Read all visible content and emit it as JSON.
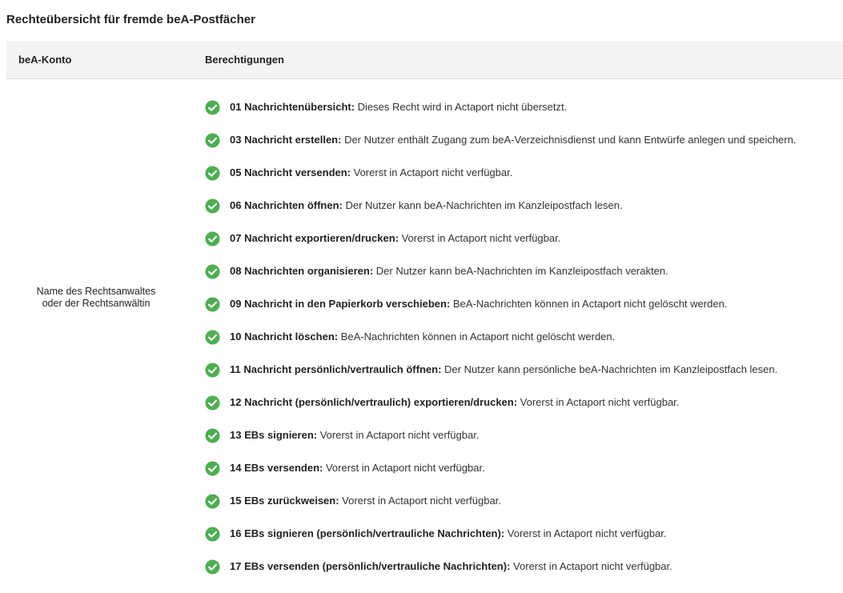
{
  "page": {
    "title": "Rechteübersicht für fremde beA-Postfächer"
  },
  "table": {
    "headers": {
      "account": "beA-Konto",
      "permissions": "Berechtigungen"
    },
    "account": {
      "line1": "Name des Rechtsanwaltes",
      "line2": "oder der Rechtsanwältin"
    },
    "check_icon": "check-circle-icon",
    "check_color": "#4caf50",
    "permissions": [
      {
        "name": "01 Nachrichtenübersicht:",
        "description": " Dieses Recht wird in Actaport nicht übersetzt."
      },
      {
        "name": "03 Nachricht erstellen:",
        "description": " Der Nutzer enthält Zugang zum beA-Verzeichnisdienst und kann Entwürfe anlegen und speichern."
      },
      {
        "name": "05 Nachricht versenden:",
        "description": " Vorerst in Actaport nicht verfügbar."
      },
      {
        "name": "06 Nachrichten öffnen:",
        "description": " Der Nutzer kann beA-Nachrichten im Kanzleipostfach lesen."
      },
      {
        "name": "07 Nachricht exportieren/drucken:",
        "description": " Vorerst in Actaport nicht verfügbar."
      },
      {
        "name": "08 Nachrichten organisieren:",
        "description": " Der Nutzer kann beA-Nachrichten im Kanzleipostfach verakten."
      },
      {
        "name": "09 Nachricht in den Papierkorb verschieben:",
        "description": " BeA-Nachrichten können in Actaport nicht gelöscht werden."
      },
      {
        "name": "10 Nachricht löschen:",
        "description": " BeA-Nachrichten können in Actaport nicht gelöscht werden."
      },
      {
        "name": "11 Nachricht persönlich/vertraulich öffnen:",
        "description": " Der Nutzer kann persönliche beA-Nachrichten im Kanzleipostfach lesen."
      },
      {
        "name": "12 Nachricht (persönlich/vertraulich) exportieren/drucken:",
        "description": " Vorerst in Actaport nicht verfügbar."
      },
      {
        "name": "13 EBs signieren:",
        "description": " Vorerst in Actaport nicht verfügbar."
      },
      {
        "name": "14 EBs versenden:",
        "description": " Vorerst in Actaport nicht verfügbar."
      },
      {
        "name": "15 EBs zurückweisen:",
        "description": " Vorerst in Actaport nicht verfügbar."
      },
      {
        "name": "16 EBs signieren (persönlich/vertrauliche Nachrichten):",
        "description": " Vorerst in Actaport nicht verfügbar."
      },
      {
        "name": "17 EBs versenden (persönlich/vertrauliche Nachrichten):",
        "description": " Vorerst in Actaport nicht verfügbar."
      }
    ]
  }
}
